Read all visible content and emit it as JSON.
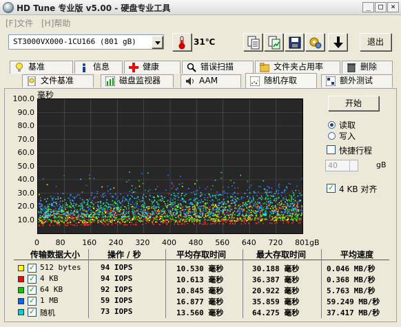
{
  "window": {
    "title": "HD Tune 专业版 v5.00 - 硬盘专业工具",
    "min_icon": "minimize-icon",
    "max_icon": "maximize-icon",
    "close_icon": "close-icon"
  },
  "menu": {
    "file": "[F]文件",
    "help": "[H]帮助"
  },
  "toolbar": {
    "drive": "ST3000VX000-1CU166 (801 gB)",
    "temperature": "31℃",
    "exit_label": "退出",
    "icons": [
      "thermometer-icon",
      "copy-text-icon",
      "copy-screen-icon",
      "save-icon",
      "settings-icon",
      "download-arrow-icon"
    ]
  },
  "tabs_row1": [
    {
      "label": "基准",
      "icon": "bulb-icon"
    },
    {
      "label": "信息",
      "icon": "info-icon"
    },
    {
      "label": "健康",
      "icon": "health-cross-icon"
    },
    {
      "label": "错误扫描",
      "icon": "magnifier-icon"
    },
    {
      "label": "文件夹占用率",
      "icon": "folder-icon"
    },
    {
      "label": "删除",
      "icon": "trash-icon"
    }
  ],
  "tabs_row2": [
    {
      "label": "文件基准",
      "icon": "file-benchmark-icon"
    },
    {
      "label": "磁盘监视器",
      "icon": "monitor-chart-icon"
    },
    {
      "label": "AAM",
      "icon": "speaker-icon"
    },
    {
      "label": "随机存取",
      "icon": "scatter-icon",
      "active": true
    },
    {
      "label": "额外测试",
      "icon": "extra-tests-icon"
    }
  ],
  "side": {
    "start_label": "开始",
    "read_label": "读取",
    "write_label": "写入",
    "short_stroke_label": "快捷行程",
    "short_stroke_value": "40",
    "short_stroke_unit": "gB",
    "align_label": "4 KB 对齐"
  },
  "chart_data": {
    "type": "scatter",
    "title": "",
    "ylabel": "毫秒",
    "xlabel": "",
    "ylim": [
      0,
      100
    ],
    "xlim": [
      0,
      801
    ],
    "y_ticks": [
      "100.0",
      "90.0",
      "80.0",
      "70.0",
      "60.0",
      "50.0",
      "40.0",
      "30.0",
      "20.0",
      "10.0"
    ],
    "x_ticks": [
      "0",
      "80",
      "160",
      "240",
      "320",
      "400",
      "480",
      "560",
      "640",
      "720",
      "801gB"
    ],
    "grid": true,
    "series": [
      {
        "name": "512 bytes",
        "color": "#ffff00",
        "band": [
          8,
          18
        ]
      },
      {
        "name": "4 KB",
        "color": "#ff2a2a",
        "band": [
          6,
          16
        ]
      },
      {
        "name": "64 KB",
        "color": "#22dd22",
        "band": [
          9,
          22
        ]
      },
      {
        "name": "1 MB",
        "color": "#2e7bff",
        "band": [
          14,
          30
        ]
      },
      {
        "name": "随机",
        "color": "#33e0e0",
        "band": [
          12,
          26
        ]
      }
    ]
  },
  "results": {
    "headers": [
      "传输数据大小",
      "操作 / 秒",
      "平均存取时间",
      "最大存取时间",
      "平均速度"
    ],
    "rows": [
      {
        "label": "512 bytes",
        "color": "#ffff00",
        "iops": "94 IOPS",
        "avg": "10.530 毫秒",
        "max": "30.188 毫秒",
        "speed": "0.046 MB/秒"
      },
      {
        "label": "4 KB",
        "color": "#ff0000",
        "iops": "94 IOPS",
        "avg": "10.613 毫秒",
        "max": "36.387 毫秒",
        "speed": "0.368 MB/秒"
      },
      {
        "label": "64 KB",
        "color": "#00cc00",
        "iops": "92 IOPS",
        "avg": "10.845 毫秒",
        "max": "20.922 毫秒",
        "speed": "5.763 MB/秒"
      },
      {
        "label": "1 MB",
        "color": "#0066ff",
        "iops": "59 IOPS",
        "avg": "16.877 毫秒",
        "max": "35.859 毫秒",
        "speed": "59.249 MB/秒"
      },
      {
        "label": "随机",
        "color": "#00d0d0",
        "iops": "73 IOPS",
        "avg": "13.560 毫秒",
        "max": "64.275 毫秒",
        "speed": "37.417 MB/秒"
      }
    ]
  }
}
